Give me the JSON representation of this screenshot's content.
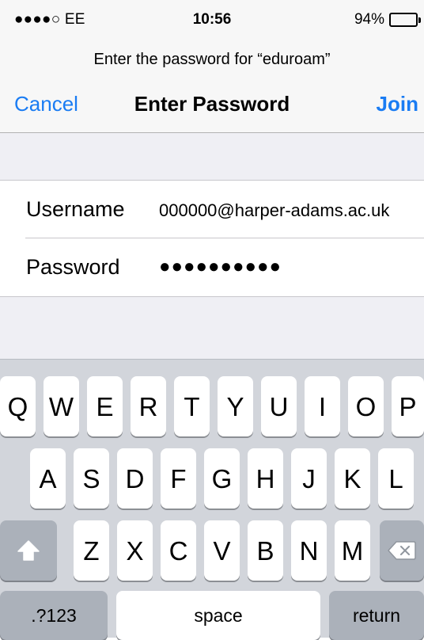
{
  "status_bar": {
    "carrier": "●●●●○ EE",
    "time": "10:56",
    "battery_percent": "94%",
    "battery_level": 0.94
  },
  "nav": {
    "prompt": "Enter the password for “eduroam”",
    "cancel_label": "Cancel",
    "title": "Enter Password",
    "join_label": "Join"
  },
  "form": {
    "username_label": "Username",
    "username_value": "000000@harper-adams.ac.uk",
    "password_label": "Password",
    "password_value": "●●●●●●●●●●"
  },
  "keyboard": {
    "row1": [
      "Q",
      "W",
      "E",
      "R",
      "T",
      "Y",
      "U",
      "I",
      "O",
      "P"
    ],
    "row2": [
      "A",
      "S",
      "D",
      "F",
      "G",
      "H",
      "J",
      "K",
      "L"
    ],
    "row3": [
      "Z",
      "X",
      "C",
      "V",
      "B",
      "N",
      "M"
    ],
    "numbers_label": ".?123",
    "space_label": "space",
    "return_label": "return",
    "shift_icon": "shift-arrow-icon",
    "delete_icon": "backspace-icon"
  },
  "colors": {
    "accent": "#1a7cf3",
    "nav_background": "#f7f7f7",
    "group_background": "#efeff4",
    "keyboard_background": "#d2d5db",
    "key_background": "#ffffff",
    "dark_key_background": "#abb1ba"
  }
}
